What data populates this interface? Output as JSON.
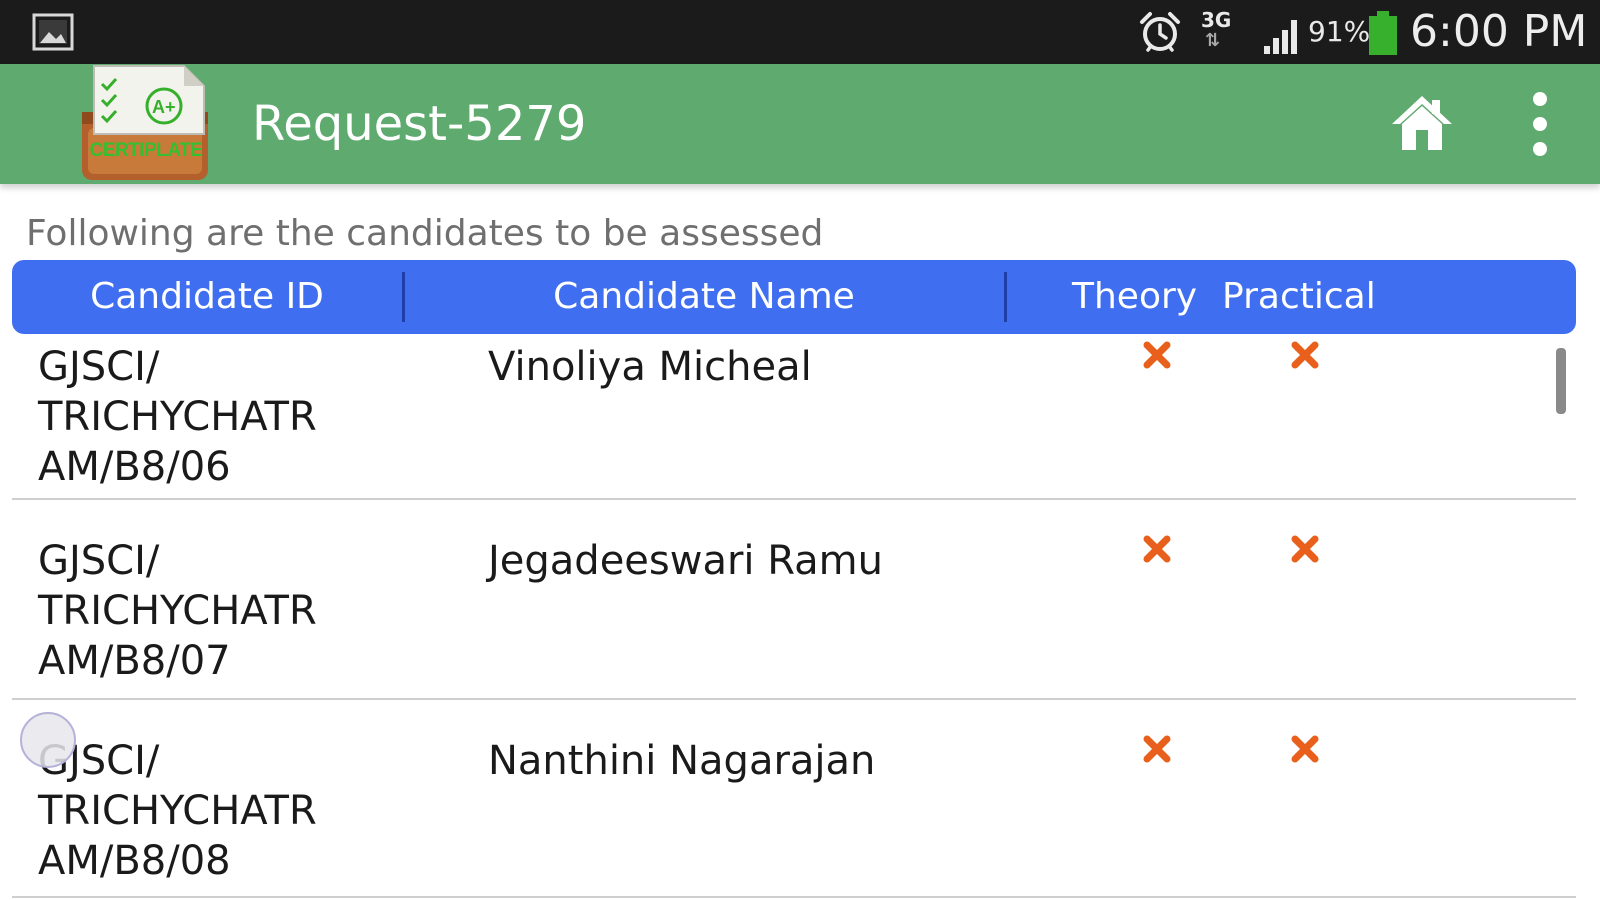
{
  "status_bar": {
    "gallery_icon": "gallery-icon",
    "alarm_icon": "alarm-icon",
    "network_type": "3G",
    "network_arrows": "⇅",
    "signal_icon": "signal-icon",
    "battery_percent": "91%",
    "battery_level": 0.91,
    "battery_color": "#37b02e",
    "time": "6:00 PM"
  },
  "action_bar": {
    "logo_text": "CERTIPLATE",
    "title": "Request-5279",
    "home_icon": "home-icon",
    "overflow_icon": "overflow-menu-icon",
    "color": "#5faa6e"
  },
  "intro": "Following are the candidates to be assessed",
  "table": {
    "header_color": "#3f6ff0",
    "columns": [
      "Candidate ID",
      "Candidate Name",
      "Theory",
      "Practical"
    ],
    "rows": [
      {
        "id": "GJSCI/\nTRICHYCHATR\nAM/B8/06",
        "name": "Vinoliya Micheal",
        "theory": "✖",
        "practical": "✖"
      },
      {
        "id": "GJSCI/\nTRICHYCHATR\nAM/B8/07",
        "name": "Jegadeeswari Ramu",
        "theory": "✖",
        "practical": "✖"
      },
      {
        "id": "GJSCI/\nTRICHYCHATR\nAM/B8/08",
        "name": "Nanthini Nagarajan",
        "theory": "✖",
        "practical": "✖"
      }
    ],
    "mark_color": "#e8601c"
  }
}
